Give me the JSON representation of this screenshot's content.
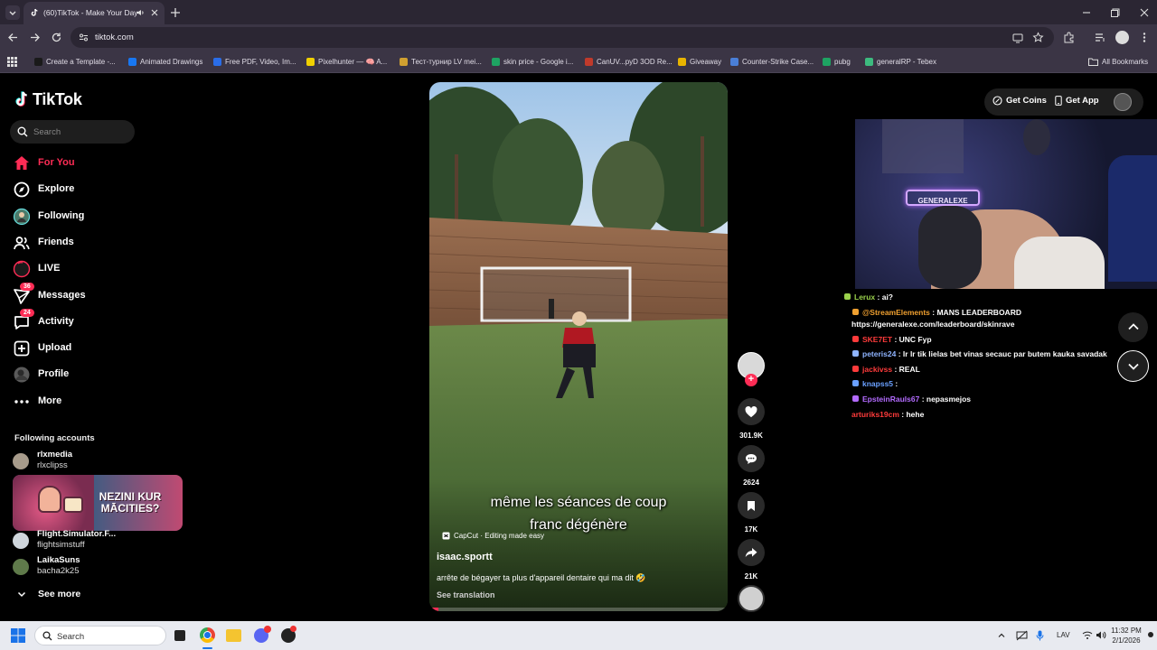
{
  "browser": {
    "tab_title": "(60)TikTok - Make Your Day",
    "url": "tiktok.com",
    "bookmarks": [
      {
        "label": "Create a Template -...",
        "color": "#1a1a1a"
      },
      {
        "label": "Animated Drawings",
        "color": "#1877f2"
      },
      {
        "label": "Free PDF, Video, Im...",
        "color": "#2a6de8"
      },
      {
        "label": "Pixelhunter — 🧠 A...",
        "color": "#f0d000"
      },
      {
        "label": "Тест-турнир LV mei...",
        "color": "#d0a030"
      },
      {
        "label": "skin price - Google i...",
        "color": "#1ea362"
      },
      {
        "label": "CanUV...pyD 3OD Re...",
        "color": "#c03a2b"
      },
      {
        "label": "Giveaway",
        "color": "#e8b400"
      },
      {
        "label": "Counter-Strike Case...",
        "color": "#4a7fd8"
      },
      {
        "label": "pubg",
        "color": "#1ea362"
      },
      {
        "label": "generalRP - Tebex",
        "color": "#3dbb7f"
      }
    ],
    "all_bookmarks": "All Bookmarks"
  },
  "sidebar": {
    "logo": "TikTok",
    "search_placeholder": "Search",
    "nav": [
      {
        "label": "For You",
        "icon": "home-icon",
        "active": true
      },
      {
        "label": "Explore",
        "icon": "compass-icon"
      },
      {
        "label": "Following",
        "icon": "following-avatar-icon"
      },
      {
        "label": "Friends",
        "icon": "friends-icon"
      },
      {
        "label": "LIVE",
        "icon": "live-icon"
      },
      {
        "label": "Messages",
        "icon": "messages-icon",
        "badge": "36"
      },
      {
        "label": "Activity",
        "icon": "activity-icon",
        "badge": "24"
      },
      {
        "label": "Upload",
        "icon": "upload-icon"
      },
      {
        "label": "Profile",
        "icon": "profile-avatar-icon"
      },
      {
        "label": "More",
        "icon": "more-icon"
      }
    ],
    "following_title": "Following accounts",
    "accounts": [
      {
        "name": "rlxmedia",
        "handle": "rlxclipss"
      },
      {
        "name": "Flight.Simulator.F...",
        "handle": "flightsimstuff"
      },
      {
        "name": "LaikaSuns",
        "handle": "bacha2k25"
      }
    ],
    "promo_text": "NEZINI KUR MĀCITIES?",
    "see_more": "See more"
  },
  "topright": {
    "get_coins": "Get Coins",
    "get_app": "Get App"
  },
  "video": {
    "caption_line1": "même les séances de coup",
    "caption_line2": "franc dégénère",
    "capcut": "CapCut · Editing made easy",
    "author": "isaac.sportt",
    "description": "arrête de bégayer ta plus d'appareil dentaire qui ma dit 🤣",
    "see_translation": "See translation",
    "likes": "301.9K",
    "comments": "2624",
    "saves": "17K",
    "shares": "21K",
    "progress": 0.03
  },
  "stream": {
    "neon_sign": "GENERALEXE",
    "chat": [
      {
        "user": "Lerux",
        "msg": ": ai?",
        "color": "#9ad14b"
      },
      {
        "user": "@StreamElements",
        "msg": ": MANS LEADERBOARD",
        "color": "#f0a030"
      },
      {
        "user": "",
        "msg": "https://generalexe.com/leaderboard/skinrave",
        "color": "#ffffff"
      },
      {
        "user": "SKE7ET",
        "msg": ": UNC Fyp",
        "color": "#ff3b3b"
      },
      {
        "user": "peteris24",
        "msg": ": lr lr tik lielas bet vinas secauc par butem kauka savadak",
        "color": "#8fb4ff"
      },
      {
        "user": "jackivss",
        "msg": ": REAL",
        "color": "#ff3b3b"
      },
      {
        "user": "knapss5",
        "msg": ":",
        "color": "#6aa0ff"
      },
      {
        "user": "EpsteinRauls67",
        "msg": ":      nepasmejos",
        "color": "#b36bff"
      },
      {
        "user": "arturiks19cm",
        "msg": ": hehe",
        "color": "#ff3b3b"
      }
    ]
  },
  "taskbar": {
    "search": "Search",
    "lang": "LAV",
    "time": "11:32 PM",
    "date": "2/1/2026"
  }
}
